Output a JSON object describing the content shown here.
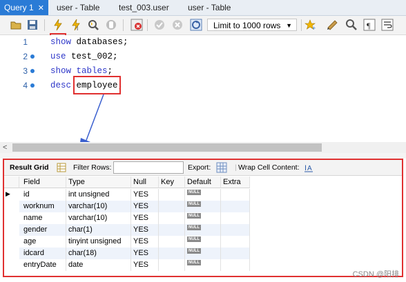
{
  "tabs": [
    {
      "label": "Query 1",
      "active": true,
      "closable": true
    },
    {
      "label": "user - Table"
    },
    {
      "label": "test_003.user"
    },
    {
      "label": "user - Table"
    }
  ],
  "toolbar": {
    "limit_label": "Limit to 1000 rows",
    "icons": [
      "folder-icon",
      "save-icon",
      "execute-icon",
      "execute-current-icon",
      "explain-icon",
      "stop-icon",
      "toggle-error-icon",
      "commit-icon",
      "rollback-icon",
      "autocommit-icon",
      "beautify-icon",
      "format-icon",
      "search-icon",
      "invisible-chars-icon",
      "wrap-icon"
    ]
  },
  "editor": {
    "lines": [
      {
        "num": "1",
        "parts": [
          {
            "t": "show",
            "kw": true
          },
          {
            "t": " databases;",
            "kw": false
          }
        ]
      },
      {
        "num": "2",
        "parts": [
          {
            "t": "use",
            "kw": true
          },
          {
            "t": " test_002;",
            "kw": false
          }
        ]
      },
      {
        "num": "3",
        "parts": [
          {
            "t": "show tables",
            "kw": true
          },
          {
            "t": ";",
            "kw": false
          }
        ]
      },
      {
        "num": "4",
        "parts": [
          {
            "t": "desc",
            "kw": true
          },
          {
            "t": " employee;",
            "kw": false
          }
        ]
      }
    ]
  },
  "results": {
    "toolbar": {
      "result_grid": "Result Grid",
      "filter_rows": "Filter Rows:",
      "export": "Export:",
      "wrap": "Wrap Cell Content:"
    },
    "columns": [
      "Field",
      "Type",
      "Null",
      "Key",
      "Default",
      "Extra"
    ],
    "null_badge": "NULL",
    "rows": [
      [
        "id",
        "int unsigned",
        "YES",
        "",
        "NULL",
        ""
      ],
      [
        "worknum",
        "varchar(10)",
        "YES",
        "",
        "NULL",
        ""
      ],
      [
        "name",
        "varchar(10)",
        "YES",
        "",
        "NULL",
        ""
      ],
      [
        "gender",
        "char(1)",
        "YES",
        "",
        "NULL",
        ""
      ],
      [
        "age",
        "tinyint unsigned",
        "YES",
        "",
        "NULL",
        ""
      ],
      [
        "idcard",
        "char(18)",
        "YES",
        "",
        "NULL",
        ""
      ],
      [
        "entryDate",
        "date",
        "YES",
        "",
        "NULL",
        ""
      ]
    ]
  },
  "watermark": "CSDN @阳排",
  "colors": {
    "accent": "#2a7bd6",
    "highlight": "#e03030",
    "keyword": "#2e37c9",
    "arrow": "#3a5fcf"
  }
}
